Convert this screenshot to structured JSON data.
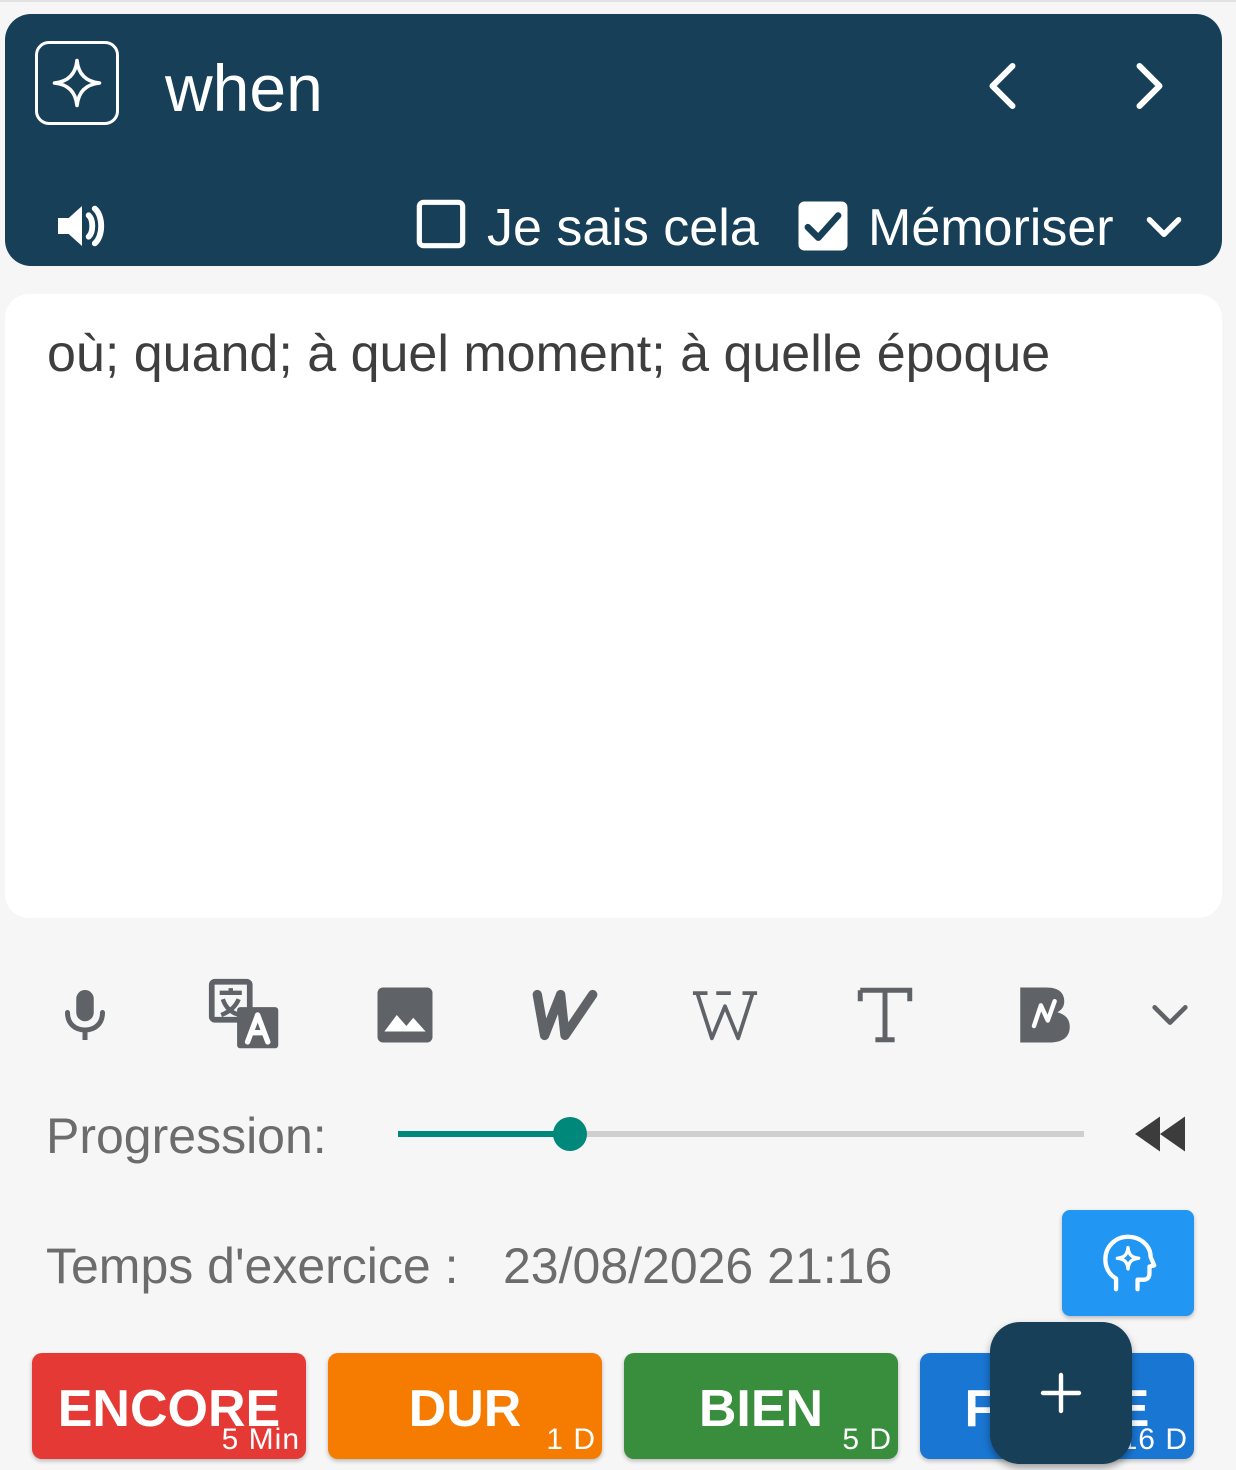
{
  "header": {
    "word": "when",
    "know_label": "Je sais cela",
    "know_checked": false,
    "memorize_label": "Mémoriser",
    "memorize_checked": true
  },
  "definition": {
    "text": "où; quand; à quel moment; à quelle époque"
  },
  "tools": [
    {
      "icon": "microphone-icon"
    },
    {
      "icon": "translate-icon"
    },
    {
      "icon": "image-icon"
    },
    {
      "icon": "wordreference-icon"
    },
    {
      "icon": "wikipedia-icon"
    },
    {
      "icon": "text-icon"
    },
    {
      "icon": "bing-icon"
    },
    {
      "icon": "chevron-down-icon"
    }
  ],
  "progress": {
    "label": "Progression:",
    "value": 0.25
  },
  "exercise": {
    "label": "Temps d'exercice :",
    "value": "23/08/2026 21:16"
  },
  "grades": [
    {
      "label": "ENCORE",
      "interval": "5 Min",
      "color": "#e53935"
    },
    {
      "label": "DUR",
      "interval": "1 D",
      "color": "#f57c00"
    },
    {
      "label": "BIEN",
      "interval": "5 D",
      "color": "#388e3c"
    },
    {
      "label": "FACILE",
      "interval": "16 D",
      "color": "#1976d2"
    }
  ],
  "colors": {
    "header_bg": "#173f57",
    "accent": "#00897b",
    "brain_button": "#2196f3"
  }
}
